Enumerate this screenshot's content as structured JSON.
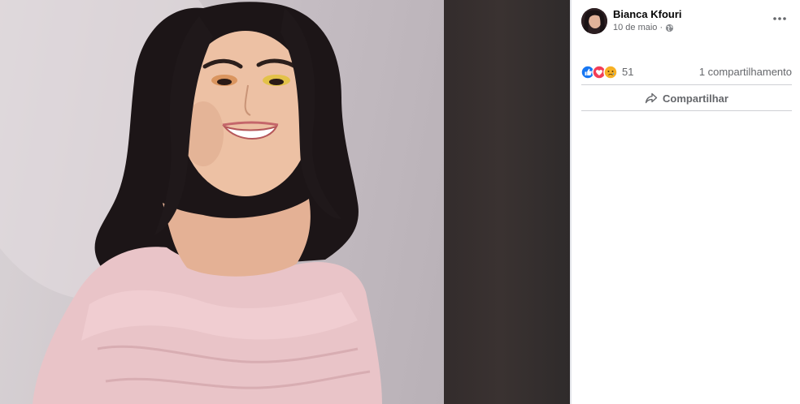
{
  "post": {
    "author": "Bianca Kfouri",
    "date": "10 de maio · ",
    "reaction_count": "51",
    "share_count": "1 compartilhamento",
    "share_label": "Compartilhar"
  },
  "icons": {
    "privacy": "globe-icon",
    "menu": "more-options-icon",
    "reactions": [
      "like-icon",
      "love-icon",
      "sad-icon"
    ],
    "share": "share-arrow-icon"
  },
  "colors": {
    "like": "#1877f2",
    "love": "#f33e58",
    "sad": "#f7b125",
    "text_secondary": "#65676b"
  }
}
